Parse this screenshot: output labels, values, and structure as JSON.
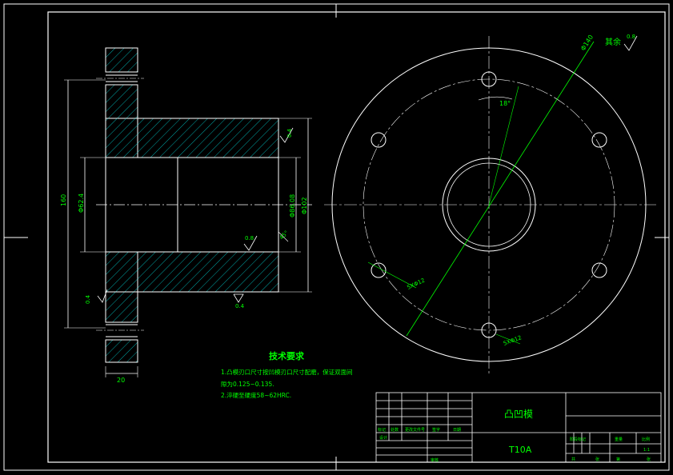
{
  "title_block": {
    "part_name": "凸凹模",
    "material": "T10A",
    "labels": [
      "标记",
      "处数",
      "更改文件号",
      "签字",
      "日期",
      "设计",
      "审核",
      "阶段标记",
      "重量",
      "比例",
      "共",
      "张",
      "第",
      "张"
    ],
    "scale": "1:1"
  },
  "tech_requirements": {
    "heading": "技术要求",
    "lines": [
      "1.凸模刃口尺寸按凹模刃口尺寸配磨，保证双面间",
      "隙为0.125~0.135.",
      "2.淬硬至硬度58~62HRC."
    ]
  },
  "dimensions": {
    "overall_diameter": "160",
    "bore_diameter": "Φ62.4",
    "punch_diameter": "Φ86.08",
    "outer_diameter": "Φ102",
    "flange_width": "20",
    "bolt_circle": "Φ140",
    "angle": "18°",
    "chamfer": "45°",
    "hole_pattern_1": "5XΦ12",
    "hole_pattern_2": "5XΦ12",
    "roughness_values": [
      "0.4",
      "0.8",
      "0.4",
      "0.4",
      "0.8"
    ],
    "other_surface_label": "其余",
    "other_surface_value": "0.8"
  }
}
